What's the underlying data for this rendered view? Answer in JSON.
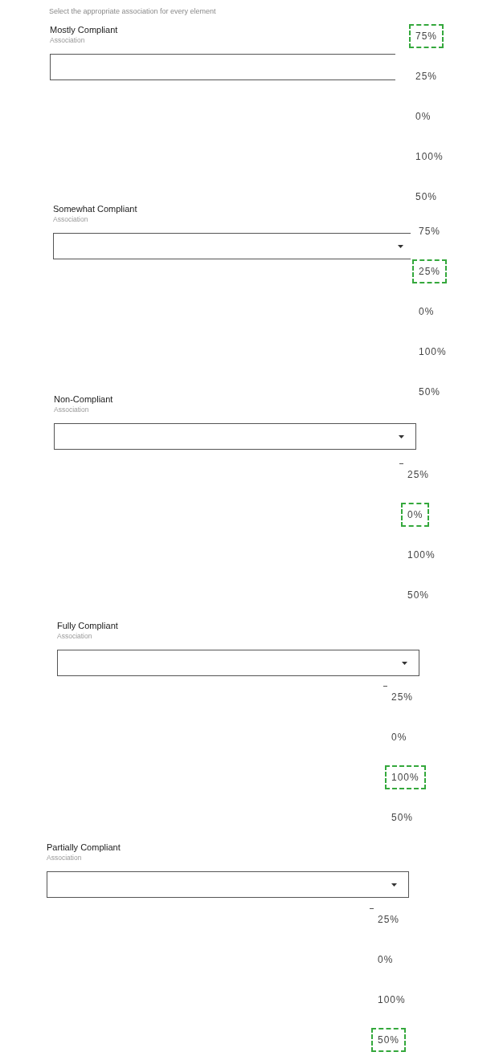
{
  "instruction": "Select the appropriate association for every element",
  "elements": [
    {
      "title": "Mostly Compliant",
      "field_label": "Association",
      "caret": false,
      "clipped_option_mark": false,
      "options": [
        {
          "label": "75%",
          "selected": true
        },
        {
          "label": "25%",
          "selected": false
        },
        {
          "label": "0%",
          "selected": false
        },
        {
          "label": "100%",
          "selected": false
        },
        {
          "label": "50%",
          "selected": false
        }
      ]
    },
    {
      "title": "Somewhat Compliant",
      "field_label": "Association",
      "caret": true,
      "clipped_option_mark": false,
      "options": [
        {
          "label": "75%",
          "selected": false
        },
        {
          "label": "25%",
          "selected": true
        },
        {
          "label": "0%",
          "selected": false
        },
        {
          "label": "100%",
          "selected": false
        },
        {
          "label": "50%",
          "selected": false
        }
      ]
    },
    {
      "title": "Non-Compliant",
      "field_label": "Association",
      "caret": true,
      "clipped_option_mark": true,
      "options": [
        {
          "label": "25%",
          "selected": false
        },
        {
          "label": "0%",
          "selected": true
        },
        {
          "label": "100%",
          "selected": false
        },
        {
          "label": "50%",
          "selected": false
        }
      ]
    },
    {
      "title": "Fully Compliant",
      "field_label": "Association",
      "caret": true,
      "clipped_option_mark": true,
      "options": [
        {
          "label": "25%",
          "selected": false
        },
        {
          "label": "0%",
          "selected": false
        },
        {
          "label": "100%",
          "selected": true
        },
        {
          "label": "50%",
          "selected": false
        }
      ]
    },
    {
      "title": "Partially Compliant",
      "field_label": "Association",
      "caret": true,
      "clipped_option_mark": true,
      "options": [
        {
          "label": "25%",
          "selected": false
        },
        {
          "label": "0%",
          "selected": false
        },
        {
          "label": "100%",
          "selected": false
        },
        {
          "label": "50%",
          "selected": true
        }
      ]
    }
  ]
}
